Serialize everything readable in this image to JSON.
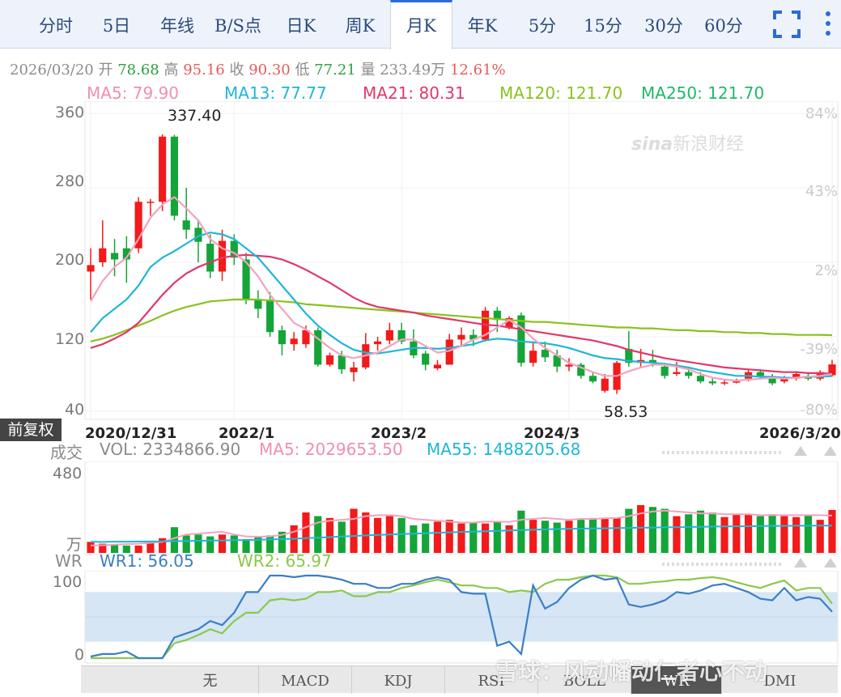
{
  "tabs": [
    "分时",
    "5日",
    "年线",
    "B/S点",
    "日K",
    "周K",
    "月K",
    "年K",
    "5分",
    "15分",
    "30分",
    "60分"
  ],
  "active_tab": "月K",
  "quote": {
    "date": "2026/03/20",
    "open_label": "开",
    "open": "78.68",
    "high_label": "高",
    "high": "95.16",
    "close_label": "收",
    "close": "90.30",
    "low_label": "低",
    "low": "77.21",
    "vol_label": "量",
    "vol": "233.49万",
    "change": "12.61%"
  },
  "ma_legend": [
    {
      "text": "MA5: 79.90",
      "color": "#f08fb0"
    },
    {
      "text": "MA13: 77.77",
      "color": "#1fb6d6"
    },
    {
      "text": "MA21: 80.31",
      "color": "#e0386a"
    },
    {
      "text": "MA120: 121.70",
      "color": "#8cc11f"
    },
    {
      "text": "MA250: 121.70",
      "color": "#1fb86a"
    }
  ],
  "price_axis": [
    "360",
    "280",
    "200",
    "120",
    "40"
  ],
  "pct_axis": [
    "84%",
    "43%",
    "2%",
    "-39%",
    "-80%"
  ],
  "date_axis": [
    "2020/12/31",
    "2022/1",
    "2023/2",
    "2024/3",
    "2026/3/20"
  ],
  "annotations": {
    "max": "337.40",
    "min": "58.53"
  },
  "fuquan": "前复权",
  "volume": {
    "label": "成交",
    "vol": "VOL: 2334866.90",
    "ma5": "MA5: 2029653.50",
    "ma55": "MA55: 1488205.68",
    "axis_top": "480",
    "unit": "万"
  },
  "wr": {
    "label": "WR",
    "wr1": "WR1: 56.05",
    "wr2": "WR2: 65.97",
    "axis_top": "100",
    "axis_bottom": "0"
  },
  "bottom_tabs": [
    "无",
    "MACD",
    "KDJ",
    "RSI",
    "BOLL",
    "WR",
    "DMI"
  ],
  "active_bottom_tab": "WR",
  "watermark": "雪球：风动幡动仁者心不动",
  "logo_text": "新浪财经",
  "colors": {
    "up": "#f21a1a",
    "down": "#13a538",
    "band": "#d6e6f5"
  },
  "chart_data": {
    "type": "candlestick",
    "period": "monthly",
    "ylim": [
      40,
      360
    ],
    "candles": [
      {
        "o": 190,
        "c": 197,
        "h": 215,
        "l": 160
      },
      {
        "o": 200,
        "c": 215,
        "h": 245,
        "l": 195
      },
      {
        "o": 210,
        "c": 203,
        "h": 225,
        "l": 185
      },
      {
        "o": 215,
        "c": 203,
        "h": 228,
        "l": 178
      },
      {
        "o": 215,
        "c": 265,
        "h": 270,
        "l": 210
      },
      {
        "o": 265,
        "c": 265,
        "h": 268,
        "l": 250
      },
      {
        "o": 265,
        "c": 335,
        "h": 337.4,
        "l": 255
      },
      {
        "o": 335,
        "c": 250,
        "h": 337,
        "l": 245
      },
      {
        "o": 245,
        "c": 235,
        "h": 280,
        "l": 225
      },
      {
        "o": 237,
        "c": 222,
        "h": 245,
        "l": 200
      },
      {
        "o": 220,
        "c": 190,
        "h": 230,
        "l": 183
      },
      {
        "o": 190,
        "c": 223,
        "h": 235,
        "l": 180
      },
      {
        "o": 223,
        "c": 205,
        "h": 230,
        "l": 197
      },
      {
        "o": 203,
        "c": 160,
        "h": 210,
        "l": 155
      },
      {
        "o": 160,
        "c": 150,
        "h": 170,
        "l": 140
      },
      {
        "o": 160,
        "c": 125,
        "h": 168,
        "l": 120
      },
      {
        "o": 127,
        "c": 112,
        "h": 132,
        "l": 100
      },
      {
        "o": 112,
        "c": 118,
        "h": 125,
        "l": 105
      },
      {
        "o": 112,
        "c": 127,
        "h": 132,
        "l": 108
      },
      {
        "o": 127,
        "c": 90,
        "h": 130,
        "l": 88
      },
      {
        "o": 90,
        "c": 100,
        "h": 103,
        "l": 88
      },
      {
        "o": 100,
        "c": 85,
        "h": 105,
        "l": 80
      },
      {
        "o": 82,
        "c": 87,
        "h": 93,
        "l": 72
      },
      {
        "o": 87,
        "c": 112,
        "h": 124,
        "l": 85
      },
      {
        "o": 112,
        "c": 115,
        "h": 120,
        "l": 105
      },
      {
        "o": 116,
        "c": 127,
        "h": 135,
        "l": 112
      },
      {
        "o": 127,
        "c": 115,
        "h": 135,
        "l": 112
      },
      {
        "o": 115,
        "c": 100,
        "h": 128,
        "l": 97
      },
      {
        "o": 102,
        "c": 90,
        "h": 105,
        "l": 84
      },
      {
        "o": 86,
        "c": 90,
        "h": 95,
        "l": 84
      },
      {
        "o": 90,
        "c": 117,
        "h": 123,
        "l": 90
      },
      {
        "o": 117,
        "c": 122,
        "h": 130,
        "l": 110
      },
      {
        "o": 122,
        "c": 117,
        "h": 128,
        "l": 110
      },
      {
        "o": 117,
        "c": 148,
        "h": 152,
        "l": 115
      },
      {
        "o": 148,
        "c": 138,
        "h": 152,
        "l": 125
      },
      {
        "o": 130,
        "c": 140,
        "h": 142,
        "l": 128
      },
      {
        "o": 143,
        "c": 92,
        "h": 146,
        "l": 88
      },
      {
        "o": 92,
        "c": 105,
        "h": 115,
        "l": 88
      },
      {
        "o": 106,
        "c": 98,
        "h": 115,
        "l": 93
      },
      {
        "o": 100,
        "c": 88,
        "h": 106,
        "l": 82
      },
      {
        "o": 88,
        "c": 90,
        "h": 97,
        "l": 83
      },
      {
        "o": 90,
        "c": 78,
        "h": 92,
        "l": 75
      },
      {
        "o": 78,
        "c": 72,
        "h": 82,
        "l": 70
      },
      {
        "o": 62,
        "c": 75,
        "h": 80,
        "l": 60
      },
      {
        "o": 63,
        "c": 92,
        "h": 94,
        "l": 58.53
      },
      {
        "o": 107,
        "c": 92,
        "h": 126,
        "l": 88
      },
      {
        "o": 92,
        "c": 95,
        "h": 107,
        "l": 88
      },
      {
        "o": 95,
        "c": 92,
        "h": 106,
        "l": 88
      },
      {
        "o": 88,
        "c": 78,
        "h": 92,
        "l": 75
      },
      {
        "o": 80,
        "c": 82,
        "h": 93,
        "l": 78
      },
      {
        "o": 82,
        "c": 78,
        "h": 88,
        "l": 75
      },
      {
        "o": 78,
        "c": 72,
        "h": 82,
        "l": 70
      },
      {
        "o": 72,
        "c": 70,
        "h": 75,
        "l": 68
      },
      {
        "o": 70,
        "c": 71,
        "h": 74,
        "l": 68
      },
      {
        "o": 72,
        "c": 72,
        "h": 75,
        "l": 70
      },
      {
        "o": 75,
        "c": 82,
        "h": 85,
        "l": 72
      },
      {
        "o": 82,
        "c": 78,
        "h": 85,
        "l": 75
      },
      {
        "o": 75,
        "c": 70,
        "h": 80,
        "l": 68
      },
      {
        "o": 72,
        "c": 75,
        "h": 78,
        "l": 70
      },
      {
        "o": 75,
        "c": 80,
        "h": 83,
        "l": 73
      },
      {
        "o": 78,
        "c": 75,
        "h": 82,
        "l": 73
      },
      {
        "o": 75,
        "c": 82,
        "h": 84,
        "l": 73
      },
      {
        "o": 78.68,
        "c": 90.3,
        "h": 95.16,
        "l": 77.21
      }
    ],
    "ma5": [
      158,
      180,
      195,
      205,
      225,
      248,
      262,
      270,
      258,
      245,
      225,
      215,
      210,
      200,
      185,
      165,
      150,
      135,
      128,
      118,
      108,
      100,
      97,
      100,
      103,
      110,
      117,
      117,
      110,
      103,
      105,
      110,
      117,
      122,
      130,
      138,
      130,
      118,
      108,
      100,
      92,
      87,
      82,
      78,
      78,
      83,
      87,
      90,
      90,
      88,
      85,
      80,
      76,
      74,
      73,
      74,
      75,
      76,
      75,
      76,
      77,
      78,
      79.9
    ],
    "ma13": [
      125,
      140,
      150,
      160,
      175,
      195,
      205,
      212,
      220,
      228,
      232,
      230,
      225,
      215,
      205,
      190,
      175,
      160,
      145,
      132,
      122,
      113,
      106,
      103,
      102,
      104,
      106,
      108,
      108,
      107,
      108,
      110,
      112,
      116,
      118,
      117,
      115,
      114,
      113,
      111,
      108,
      104,
      100,
      97,
      96,
      94,
      93,
      92,
      91,
      89,
      87,
      84,
      82,
      80,
      78,
      78,
      77,
      77,
      76,
      76,
      77,
      77,
      77.8
    ],
    "ma21": [
      108,
      112,
      118,
      125,
      135,
      150,
      165,
      178,
      188,
      195,
      200,
      205,
      207,
      208,
      207,
      206,
      203,
      198,
      192,
      185,
      178,
      170,
      162,
      156,
      152,
      150,
      148,
      146,
      143,
      141,
      139,
      137,
      135,
      133,
      132,
      130,
      128,
      126,
      124,
      122,
      120,
      118,
      116,
      113,
      110,
      106,
      103,
      100,
      97,
      95,
      93,
      91,
      89,
      87,
      86,
      85,
      84,
      83,
      82,
      82,
      81,
      81,
      80.3
    ],
    "ma120": [
      115,
      118,
      122,
      127,
      132,
      137,
      143,
      148,
      152,
      155,
      158,
      159,
      160,
      160,
      160,
      159,
      158,
      157,
      155,
      154,
      153,
      152,
      151,
      150,
      149,
      148,
      147,
      146,
      145,
      144,
      143,
      142,
      141,
      140,
      139,
      138,
      137,
      136,
      136,
      135,
      134,
      133,
      132,
      131,
      130,
      130,
      129,
      129,
      128,
      127,
      127,
      126,
      126,
      125,
      125,
      124,
      124,
      123,
      123,
      122,
      122,
      122,
      121.7
    ],
    "volume_unit": "万",
    "volume_ylim": [
      0,
      480
    ],
    "volume": [
      60,
      50,
      45,
      40,
      40,
      60,
      80,
      140,
      95,
      100,
      90,
      100,
      95,
      75,
      85,
      95,
      115,
      150,
      220,
      200,
      190,
      170,
      240,
      220,
      190,
      200,
      190,
      150,
      160,
      170,
      180,
      160,
      165,
      160,
      170,
      150,
      230,
      180,
      175,
      165,
      175,
      180,
      190,
      190,
      190,
      240,
      260,
      250,
      240,
      200,
      210,
      230,
      220,
      195,
      210,
      210,
      200,
      210,
      200,
      195,
      205,
      180,
      233.49
    ],
    "vol_ma5": [
      40,
      42,
      45,
      48,
      50,
      55,
      60,
      80,
      100,
      105,
      110,
      115,
      100,
      90,
      88,
      90,
      98,
      115,
      140,
      165,
      175,
      180,
      185,
      200,
      205,
      205,
      200,
      185,
      180,
      175,
      170,
      165,
      165,
      170,
      170,
      168,
      180,
      185,
      190,
      185,
      180,
      185,
      185,
      188,
      190,
      200,
      215,
      225,
      230,
      225,
      220,
      215,
      215,
      210,
      210,
      210,
      205,
      205,
      205,
      205,
      205,
      205,
      203
    ],
    "vol_ma55": [
      60,
      60,
      61,
      61,
      62,
      62,
      63,
      64,
      65,
      66,
      67,
      68,
      69,
      70,
      72,
      73,
      75,
      77,
      80,
      83,
      86,
      89,
      92,
      95,
      98,
      100,
      103,
      105,
      107,
      110,
      112,
      114,
      116,
      118,
      120,
      122,
      124,
      126,
      128,
      130,
      131,
      132,
      133,
      134,
      135,
      136,
      137,
      138,
      139,
      140,
      141,
      142,
      143,
      144,
      145,
      145,
      146,
      147,
      147,
      148,
      148,
      149,
      149
    ],
    "wr_ylim": [
      0,
      100
    ],
    "wr1": [
      2,
      5,
      5,
      8,
      0,
      0,
      0,
      25,
      30,
      35,
      45,
      40,
      55,
      80,
      80,
      100,
      100,
      98,
      100,
      100,
      98,
      95,
      90,
      90,
      85,
      85,
      90,
      90,
      95,
      98,
      95,
      80,
      78,
      78,
      15,
      20,
      5,
      88,
      60,
      68,
      85,
      95,
      100,
      95,
      97,
      65,
      62,
      65,
      70,
      80,
      78,
      82,
      88,
      90,
      85,
      80,
      72,
      70,
      85,
      70,
      74,
      72,
      56.05
    ],
    "wr2": [
      0,
      0,
      0,
      0,
      0,
      0,
      0,
      18,
      22,
      28,
      35,
      30,
      45,
      55,
      55,
      70,
      72,
      70,
      72,
      80,
      80,
      82,
      75,
      75,
      80,
      80,
      85,
      88,
      92,
      95,
      92,
      88,
      88,
      85,
      85,
      80,
      82,
      80,
      90,
      95,
      95,
      98,
      100,
      100,
      98,
      90,
      90,
      92,
      93,
      95,
      95,
      97,
      98,
      96,
      92,
      88,
      85,
      90,
      94,
      82,
      85,
      85,
      65.97
    ]
  }
}
